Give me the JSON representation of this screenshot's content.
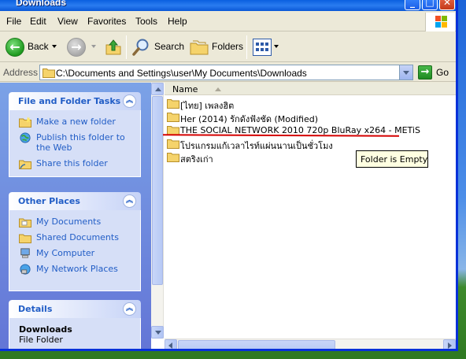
{
  "window": {
    "title": "Downloads"
  },
  "menu": [
    "File",
    "Edit",
    "View",
    "Favorites",
    "Tools",
    "Help"
  ],
  "toolbar": {
    "back": "Back",
    "search": "Search",
    "folders": "Folders"
  },
  "address": {
    "label": "Address",
    "path": "C:\\Documents and Settings\\user\\My Documents\\Downloads",
    "go": "Go"
  },
  "tasks_panel": {
    "title": "File and Folder Tasks",
    "items": [
      "Make a new folder",
      "Publish this folder to the Web",
      "Share this folder"
    ]
  },
  "places_panel": {
    "title": "Other Places",
    "items": [
      "My Documents",
      "Shared Documents",
      "My Computer",
      "My Network Places"
    ]
  },
  "details_panel": {
    "title": "Details",
    "name": "Downloads",
    "type": "File Folder"
  },
  "files": {
    "column": "Name",
    "rows": [
      "[ไทย] เพลงฮิต",
      "Her (2014) รักดังฟังชัด (Modified)",
      "THE SOCIAL NETWORK 2010 720p BluRay x264 - METiS",
      "โปรแกรมแก้เวลาไรท์แผ่นนานเป็นชั่วโมง",
      "สตริงเก่า"
    ]
  },
  "tooltip": "Folder is Empty",
  "colors": {
    "titlebar": "#0a5fe0",
    "taskpane": "#7ba2e7",
    "link": "#215dc6",
    "annotation": "#d40000"
  }
}
